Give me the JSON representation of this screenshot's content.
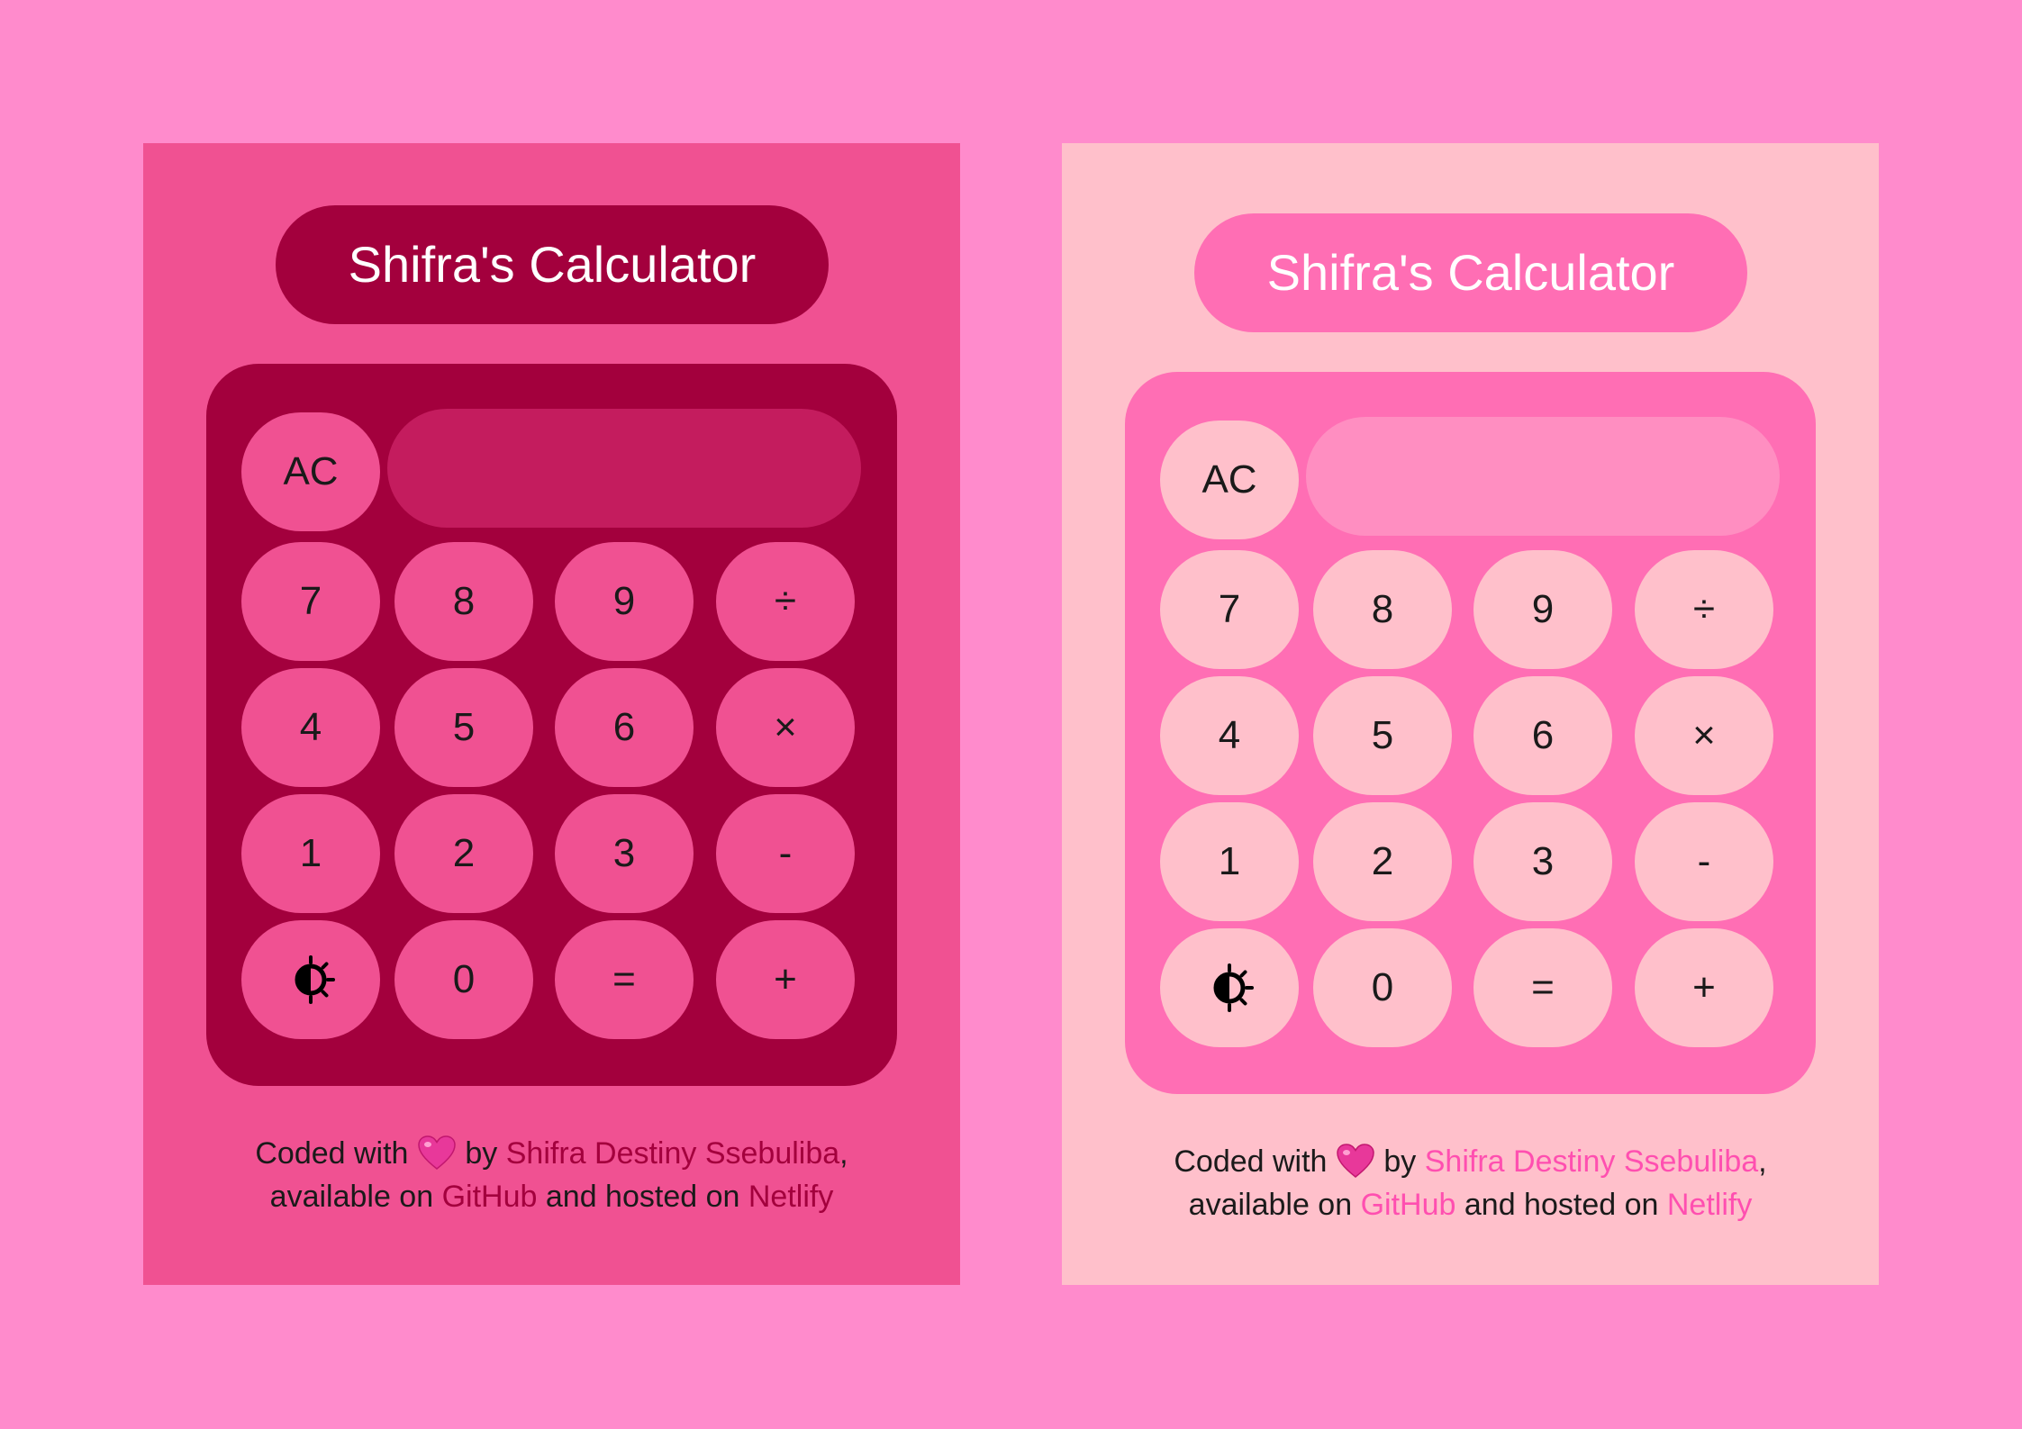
{
  "colors": {
    "page_background": "#ff8bcc",
    "dark_theme": {
      "panel": "#f05192",
      "accent": "#a3003d",
      "display": "#c41c5e",
      "key": "#f05192",
      "link": "#a3003d"
    },
    "light_theme": {
      "panel": "#ffc0cb",
      "accent": "#ff6eb4",
      "display": "#ff8ec1",
      "key": "#ffc0cb",
      "link": "#ff4fb0"
    }
  },
  "calculator": {
    "title": "Shifra's Calculator",
    "display_value": "",
    "keys": {
      "clear": "AC",
      "seven": "7",
      "eight": "8",
      "nine": "9",
      "divide": "÷",
      "four": "4",
      "five": "5",
      "six": "6",
      "multiply": "×",
      "one": "1",
      "two": "2",
      "three": "3",
      "subtract": "-",
      "theme_toggle_icon": "theme-toggle-icon",
      "zero": "0",
      "equals": "=",
      "add": "+"
    }
  },
  "footer": {
    "coded_with": "Coded with",
    "heart_icon": "heart-icon",
    "by": "by",
    "author_link": "Shifra Destiny Ssebuliba",
    "comma": ",",
    "available_on": "available on",
    "github_link": "GitHub",
    "and_hosted_on": "and hosted on",
    "netlify_link": "Netlify"
  }
}
